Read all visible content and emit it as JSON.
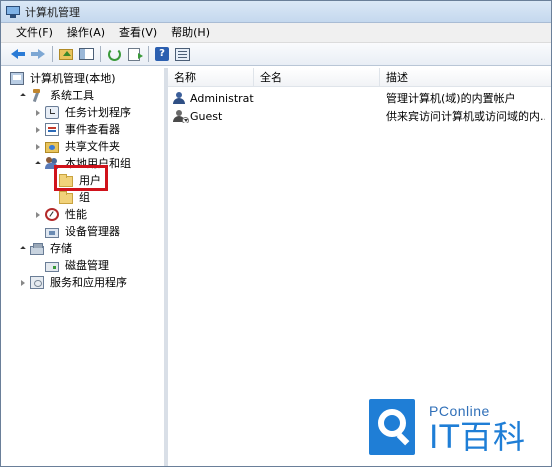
{
  "window": {
    "title": "计算机管理"
  },
  "menu": [
    {
      "label": "文件(F)"
    },
    {
      "label": "操作(A)"
    },
    {
      "label": "查看(V)"
    },
    {
      "label": "帮助(H)"
    }
  ],
  "toolbar": {
    "buttons": [
      {
        "icon": "back-arrow-icon"
      },
      {
        "icon": "forward-arrow-icon"
      },
      {
        "icon": "up-folder-icon"
      },
      {
        "icon": "show-hide-tree-icon"
      },
      {
        "icon": "refresh-icon"
      },
      {
        "icon": "export-list-icon"
      },
      {
        "icon": "help-icon",
        "glyph": "?"
      },
      {
        "icon": "properties-icon"
      }
    ]
  },
  "tree": {
    "root": "计算机管理(本地)",
    "system_tools": "系统工具",
    "task_scheduler": "任务计划程序",
    "event_viewer": "事件查看器",
    "shared_folders": "共享文件夹",
    "local_users_groups": "本地用户和组",
    "users": "用户",
    "groups": "组",
    "performance": "性能",
    "device_manager": "设备管理器",
    "storage": "存储",
    "disk_management": "磁盘管理",
    "services_apps": "服务和应用程序"
  },
  "list": {
    "columns": [
      "名称",
      "全名",
      "描述"
    ],
    "rows": [
      {
        "name": "Administrat...",
        "full_name": "",
        "description": "管理计算机(域)的内置帐户"
      },
      {
        "name": "Guest",
        "full_name": "",
        "description": "供来宾访问计算机或访问域的内..."
      }
    ]
  },
  "watermark": {
    "brand": "PConline",
    "name": "IT百科"
  },
  "colors": {
    "highlight": "#d0121b",
    "accent": "#1f7ed6"
  }
}
